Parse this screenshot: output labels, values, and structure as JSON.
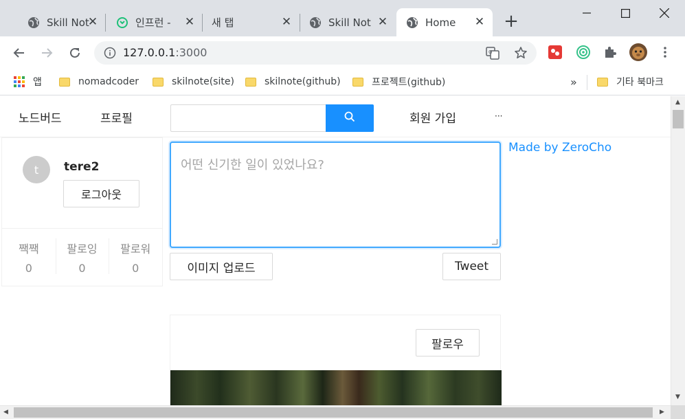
{
  "browser": {
    "tabs": [
      {
        "title": "Skill Note",
        "icon": "globe-icon"
      },
      {
        "title": "인프런 -",
        "icon": "inflearn-icon"
      },
      {
        "title": "새 탭",
        "icon": ""
      },
      {
        "title": "Skill Note",
        "icon": "globe-icon"
      },
      {
        "title": "Home",
        "icon": "globe-icon",
        "active": true
      }
    ],
    "url_host": "127.0.0.1",
    "url_port": ":3000",
    "bookmarks": [
      {
        "label": "앱",
        "icon": "apps-grid-icon"
      },
      {
        "label": "nomadcoder",
        "icon": "folder-icon"
      },
      {
        "label": "skilnote(site)",
        "icon": "folder-icon"
      },
      {
        "label": "skilnote(github)",
        "icon": "folder-icon"
      },
      {
        "label": "프로젝트(github)",
        "icon": "folder-icon"
      }
    ],
    "bookmarks_overflow": "»",
    "other_bookmarks": "기타 북마크"
  },
  "page": {
    "menu": {
      "home": "노드버드",
      "profile": "프로필",
      "signup": "회원 가입",
      "more": "···"
    },
    "search": {
      "placeholder": ""
    },
    "profile_card": {
      "avatar_letter": "t",
      "nickname": "tere2",
      "logout": "로그아웃",
      "stats": [
        {
          "label": "짹짹",
          "value": "0"
        },
        {
          "label": "팔로잉",
          "value": "0"
        },
        {
          "label": "팔로워",
          "value": "0"
        }
      ]
    },
    "post_form": {
      "placeholder": "어떤 신기한 일이 있었나요?",
      "image_upload": "이미지 업로드",
      "tweet": "Tweet"
    },
    "credit": "Made by ZeroCho",
    "post": {
      "follow": "팔로우"
    }
  },
  "colors": {
    "primary": "#1890ff",
    "tabstrip": "#dee1e6"
  }
}
